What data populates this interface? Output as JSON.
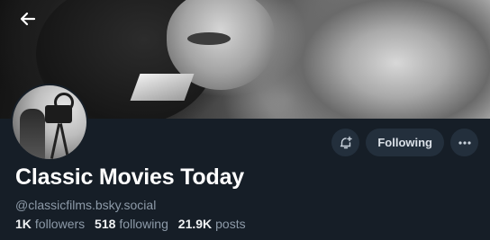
{
  "profile": {
    "display_name": "Classic Movies Today",
    "handle": "@classicfilms.bsky.social",
    "followers_count": "1K",
    "followers_label": "followers",
    "following_count": "518",
    "following_label": "following",
    "posts_count": "21.9K",
    "posts_label": "posts"
  },
  "actions": {
    "following_label": "Following",
    "notify_icon": "bell-plus-icon",
    "more_icon": "ellipsis-icon"
  },
  "navigation": {
    "back_icon": "arrow-left-icon"
  },
  "colors": {
    "background": "#161e27",
    "button_bg": "#232f3c",
    "muted_text": "#8d9aa8",
    "primary_text": "#f1f3f5"
  }
}
